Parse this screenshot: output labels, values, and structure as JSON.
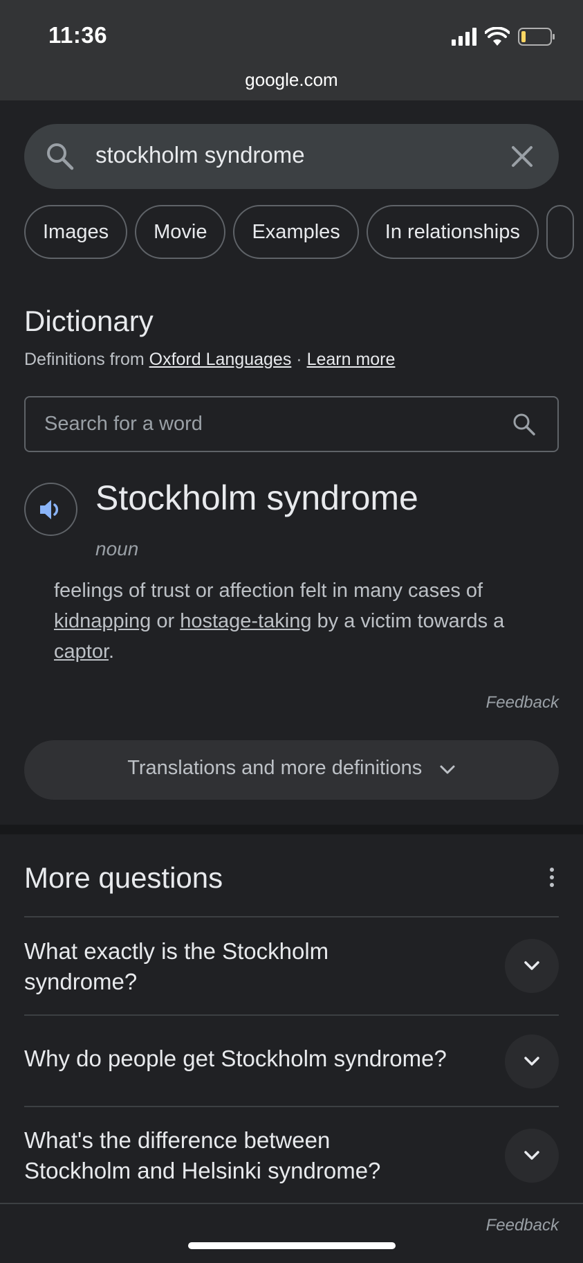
{
  "status_bar": {
    "time": "11:36",
    "url": "google.com",
    "icons": [
      "signal-icon",
      "wifi-icon",
      "battery-icon"
    ]
  },
  "search": {
    "query": "stockholm syndrome",
    "search_icon": "search-icon",
    "clear_icon": "close-icon"
  },
  "chips": [
    "Images",
    "Movie",
    "Examples",
    "In relationships"
  ],
  "dictionary": {
    "title": "Dictionary",
    "definitions_from": "Definitions from",
    "source_link": "Oxford Languages",
    "separator": "·",
    "learn_more": "Learn more",
    "search_placeholder": "Search for a word",
    "headword": "Stockholm syndrome",
    "part_of_speech": "noun",
    "definition": {
      "part1": "feelings of trust or affection felt in many cases of ",
      "link1": "kidnapping",
      "part2": " or ",
      "link2": "hostage-taking",
      "part3": " by a victim towards a ",
      "link3": "captor",
      "part4": "."
    },
    "feedback": "Feedback",
    "more_button": "Translations and more definitions"
  },
  "more_questions": {
    "title": "More questions",
    "items": [
      {
        "question": "What exactly is the Stockholm syndrome?"
      },
      {
        "question": "Why do people get Stockholm syndrome?"
      },
      {
        "question": "What's the difference between Stockholm and Helsinki syndrome?"
      }
    ],
    "feedback": "Feedback"
  },
  "colors": {
    "background": "#202124",
    "accent_blue": "#8ab4f8",
    "battery_level": "#fdd663"
  }
}
